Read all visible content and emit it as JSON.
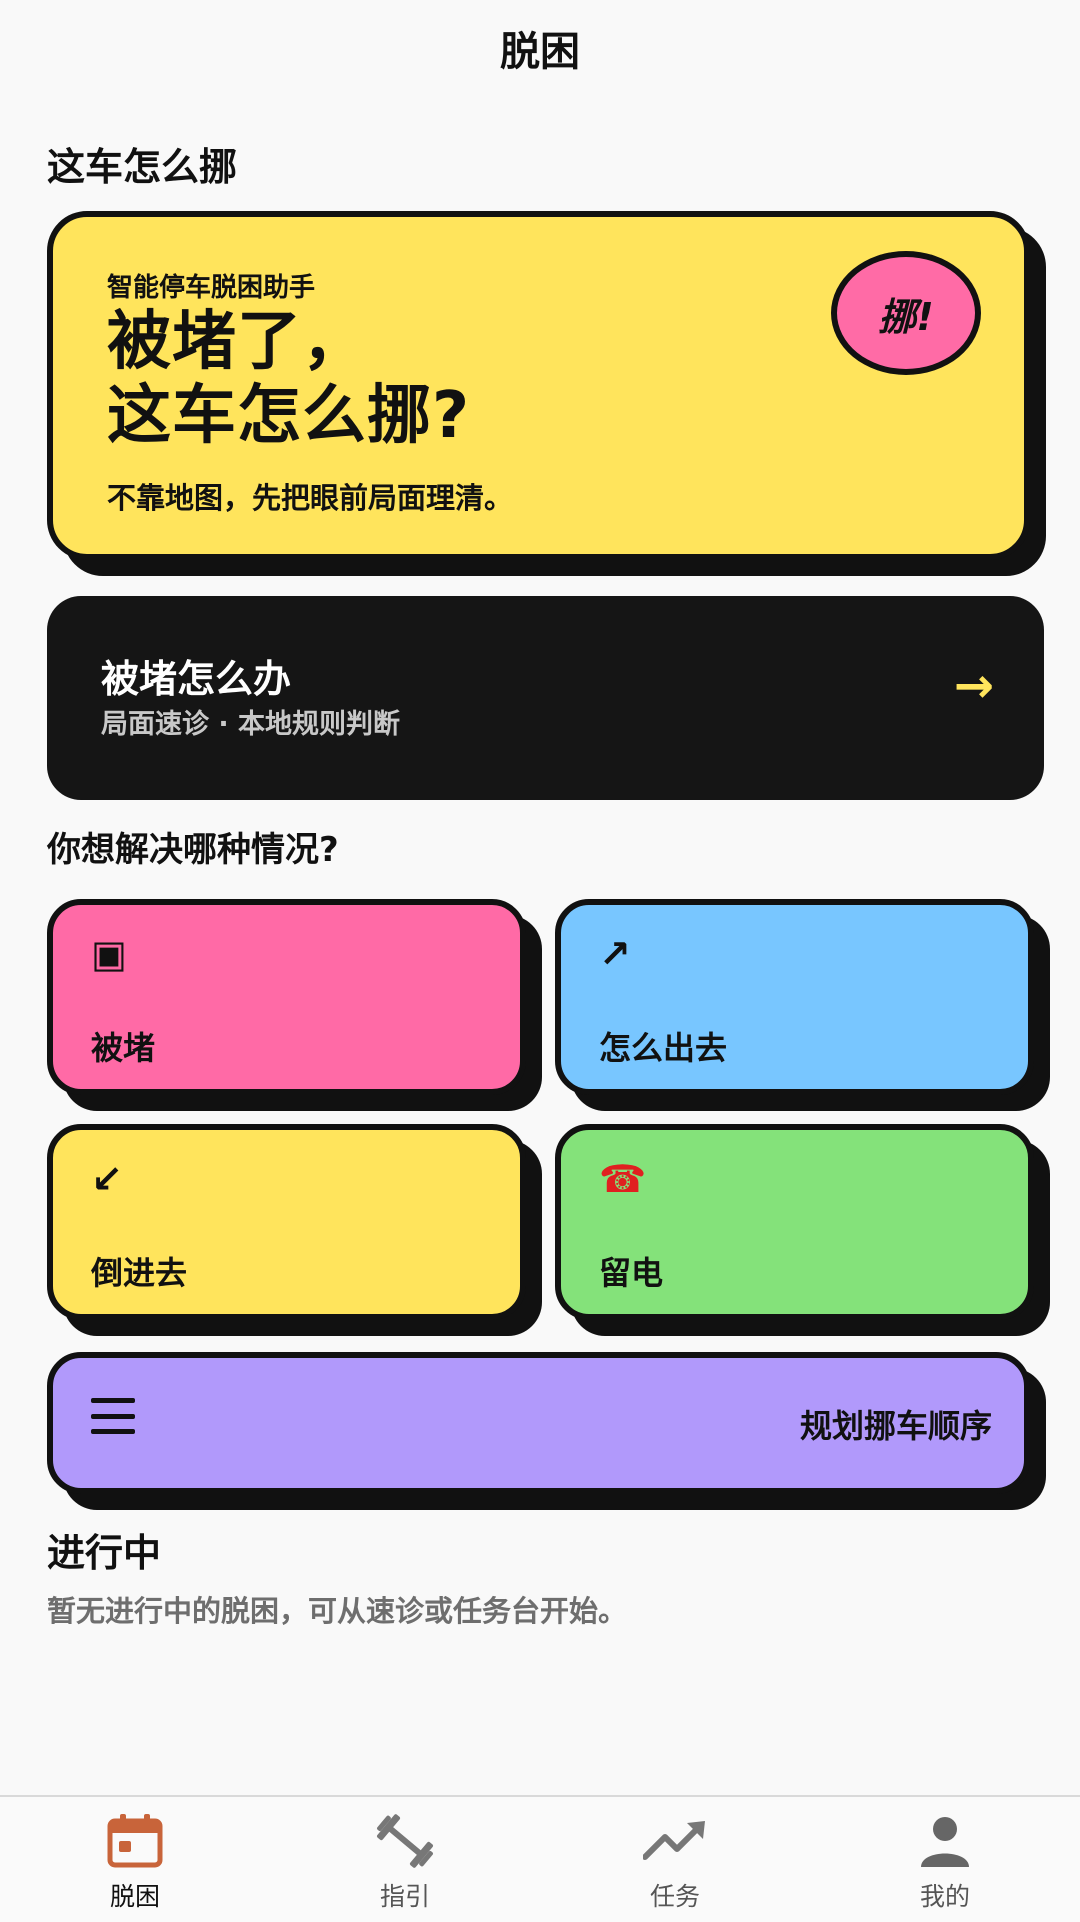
{
  "header": {
    "title": "脱困"
  },
  "hero_section": {
    "title": "这车怎么挪"
  },
  "hero": {
    "kicker": "智能停车脱困助手",
    "headline_line1": "被堵了，",
    "headline_line2": "这车怎么挪?",
    "tagline": "不靠地图，先把眼前局面理清。",
    "badge": "挪!"
  },
  "quick_card": {
    "title": "被堵怎么办",
    "subtitle": "局面速诊 · 本地规则判断",
    "arrow": "→"
  },
  "situations": {
    "title": "你想解决哪种情况?",
    "tiles": [
      {
        "label": "被堵",
        "icon": "▣",
        "icon_name": "square-icon",
        "color": "#ff6aa6"
      },
      {
        "label": "怎么出去",
        "icon": "↗",
        "icon_name": "arrow-up-right-icon",
        "color": "#78c6ff"
      },
      {
        "label": "倒进去",
        "icon": "↙",
        "icon_name": "arrow-down-left-icon",
        "color": "#ffe45c"
      },
      {
        "label": "留电",
        "icon": "☎",
        "icon_name": "telephone-icon",
        "color": "#84e27a"
      }
    ],
    "plan_button": {
      "label": "规划挪车顺序",
      "icon_name": "menu-icon",
      "color": "#b199fb"
    }
  },
  "in_progress": {
    "title": "进行中",
    "empty_text": "暂无进行中的脱困，可从速诊或任务台开始。"
  },
  "bottom_nav": {
    "items": [
      {
        "label": "脱困",
        "icon_name": "calendar-icon",
        "active": true,
        "color": "#c8643a"
      },
      {
        "label": "指引",
        "icon_name": "dumbbell-icon",
        "active": false
      },
      {
        "label": "任务",
        "icon_name": "trending-up-icon",
        "active": false
      },
      {
        "label": "我的",
        "icon_name": "person-icon",
        "active": false
      }
    ]
  },
  "colors": {
    "background": "#f9f9f9",
    "yellow": "#ffe45c",
    "pink": "#ff6aa6",
    "blue": "#78c6ff",
    "green": "#84e27a",
    "purple": "#b199fb",
    "dark": "#151515"
  }
}
